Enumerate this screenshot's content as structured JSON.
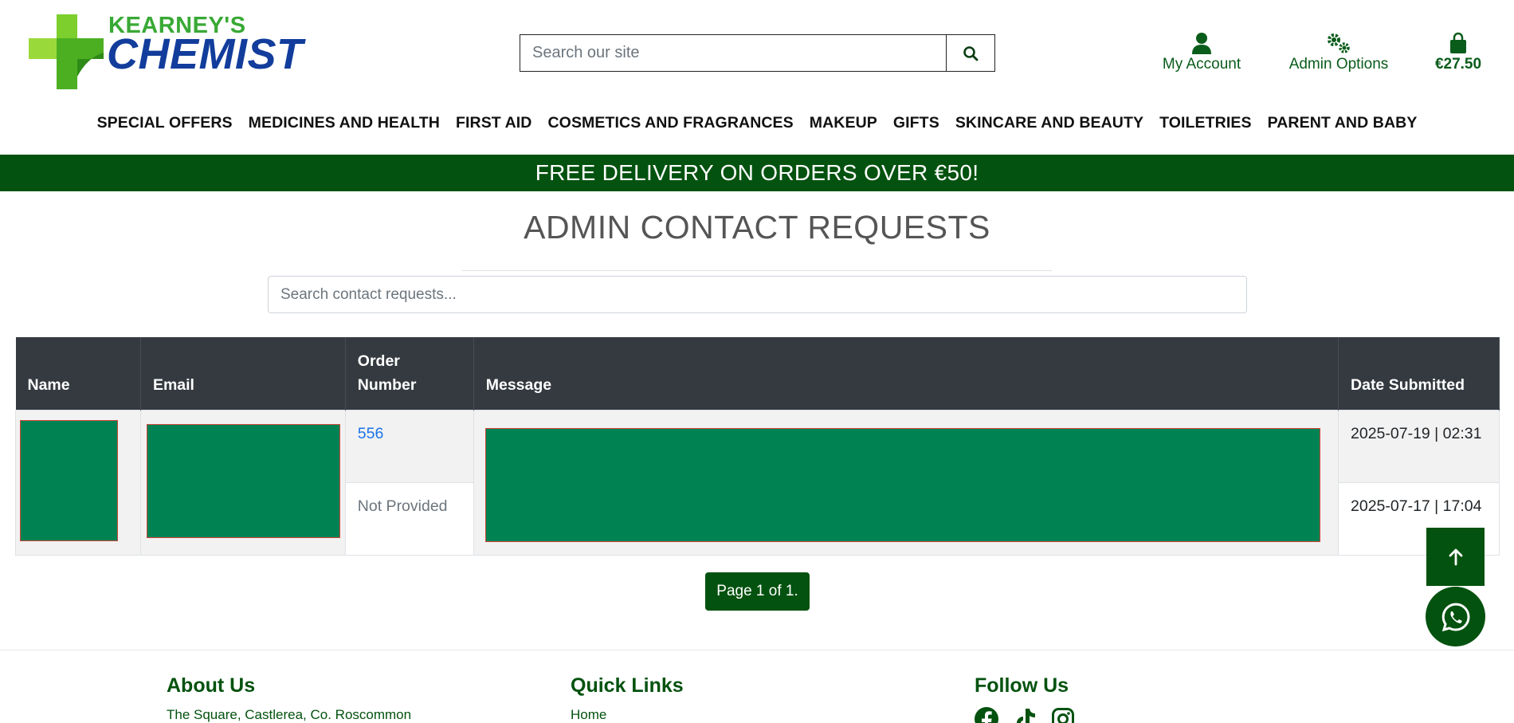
{
  "brand": {
    "top": "KEARNEY'S",
    "main": "CHEMIST"
  },
  "search": {
    "placeholder": "Search our site"
  },
  "header_links": {
    "account": "My Account",
    "admin": "Admin Options",
    "cart_total": "€27.50"
  },
  "nav": [
    "SPECIAL OFFERS",
    "MEDICINES AND HEALTH",
    "FIRST AID",
    "COSMETICS AND FRAGRANCES",
    "MAKEUP",
    "GIFTS",
    "SKINCARE AND BEAUTY",
    "TOILETRIES",
    "PARENT AND BABY"
  ],
  "banner": "FREE DELIVERY ON ORDERS OVER €50!",
  "page_title": "ADMIN CONTACT REQUESTS",
  "filter": {
    "placeholder": "Search contact requests..."
  },
  "table": {
    "headers": [
      "Name",
      "Email",
      "Order Number",
      "Message",
      "Date Submitted"
    ],
    "rows": [
      {
        "order": "556",
        "date": "2025-07-19 | 02:31"
      },
      {
        "order": "Not Provided",
        "date": "2025-07-17 | 17:04"
      }
    ]
  },
  "pager": "Page 1 of 1.",
  "footer": {
    "about": {
      "heading": "About Us",
      "address": "The Square, Castlerea, Co. Roscommon"
    },
    "quick_links": {
      "heading": "Quick Links",
      "first": "Home"
    },
    "follow": {
      "heading": "Follow Us"
    }
  },
  "colors": {
    "brand_green": "#03520f",
    "header_dark": "#343a40",
    "redaction": "#008253",
    "link_blue": "#1a73e8"
  }
}
